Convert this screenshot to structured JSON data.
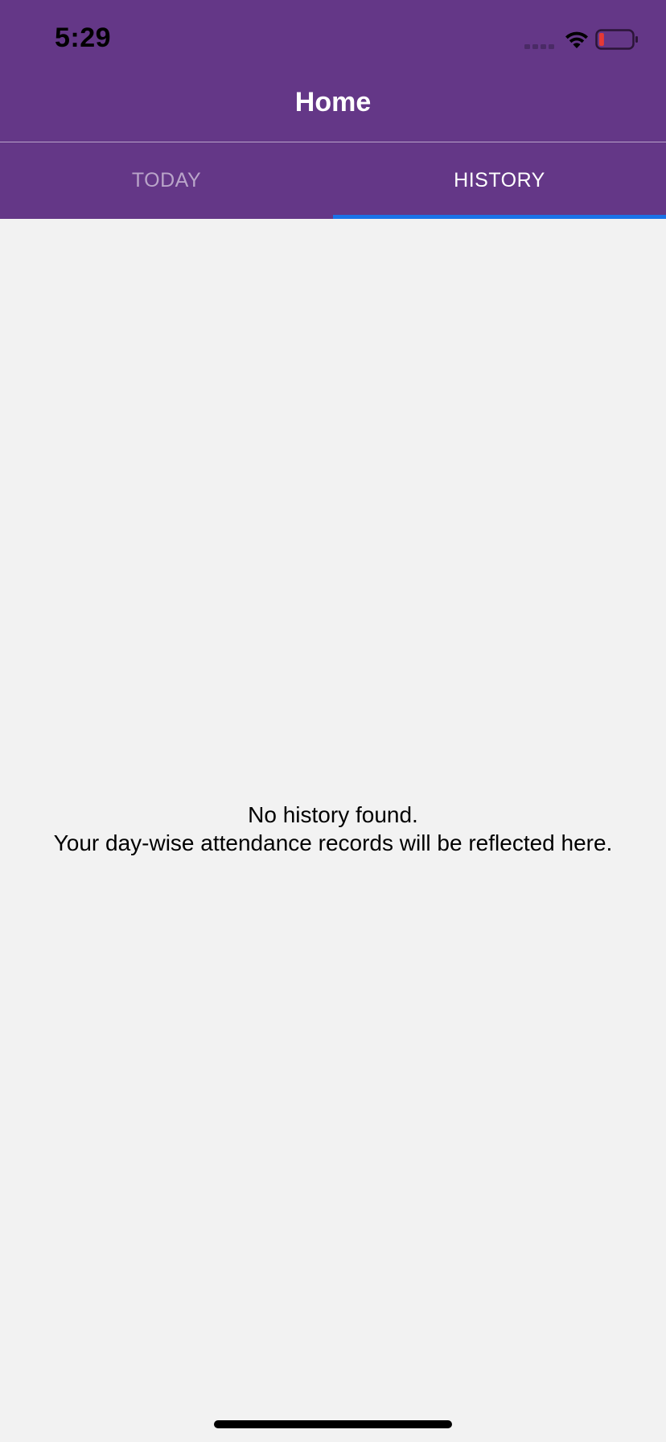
{
  "status_bar": {
    "time": "5:29",
    "signal_icon": "cellular-signal-icon",
    "wifi_icon": "wifi-icon",
    "battery_icon": "battery-low-icon",
    "battery_level": 0.1
  },
  "header": {
    "title": "Home"
  },
  "tabs": [
    {
      "label": "TODAY",
      "selected": false
    },
    {
      "label": "HISTORY",
      "selected": true
    }
  ],
  "empty_state": {
    "line1": "No history found.",
    "line2": "Your day-wise attendance records will be reflected here."
  },
  "colors": {
    "header_background": "#643787",
    "tab_indicator": "#1a73e8",
    "content_background": "#f2f2f2",
    "battery_low": "#e53935"
  }
}
